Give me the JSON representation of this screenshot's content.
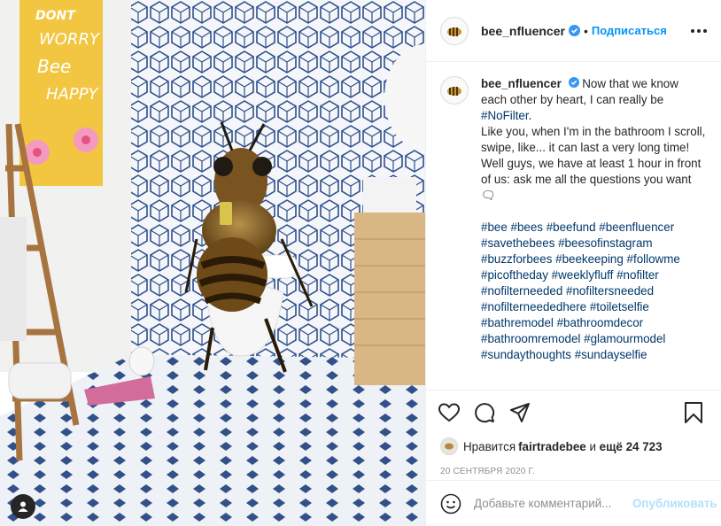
{
  "post": {
    "image_alt": "Bee sitting on toilet in bathroom with poster",
    "poster_text": [
      "DONT",
      "WORRY",
      "Bee",
      "HAPPY"
    ]
  },
  "header": {
    "username": "bee_nfluencer",
    "separator": "•",
    "follow_label": "Подписаться"
  },
  "caption": {
    "username": "bee_nfluencer",
    "line1": " Now that we know each other by heart, I can really be ",
    "nofilter": "#NoFilter",
    "line1_end": ".",
    "line2": "Like you, when I'm in the bathroom I scroll, swipe, like... it can last a very long time!",
    "line3": "Well guys, we have at least 1 hour in front of us: ask me all the questions you want 🗨",
    "hashtags": "#bee #bees #beefund #beenfluencer #savethebees #beesofinstagram #buzzforbees #beekeeping #followme #picoftheday #weeklyfluff #nofilter #nofilterneeded #nofiltersneeded #nofilterneededhere #toiletselfie #bathremodel #bathroomdecor #bathroomremodel #glamourmodel #sundaythoughts #sundayselfie"
  },
  "likes": {
    "prefix": "Нравится ",
    "user": "fairtradebee",
    "middle": " и ",
    "count": "ещё 24 723"
  },
  "date": "20 СЕНТЯБРЯ 2020 Г.",
  "comment": {
    "placeholder": "Добавьте комментарий...",
    "publish_label": "Опубликовать"
  },
  "colors": {
    "accent": "#0095f6",
    "hashtag": "#00376b",
    "poster": "#f2c640",
    "tile_blue": "#2e4f8a"
  },
  "icons": [
    "like-icon",
    "comment-icon",
    "share-icon",
    "save-icon",
    "emoji-icon",
    "more-icon",
    "verified-icon",
    "user-tag-icon"
  ]
}
